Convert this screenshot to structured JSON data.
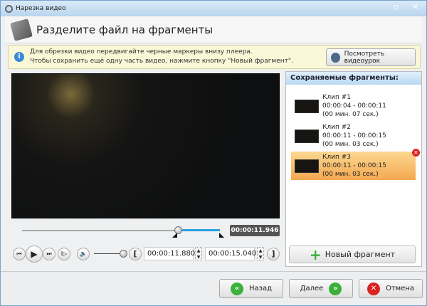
{
  "window": {
    "title": "Нарезка видео"
  },
  "header": {
    "title": "Разделите файл на фрагменты"
  },
  "info": {
    "line1": "Для обрезки видео передвигайте черные маркеры внизу плеера.",
    "line2": "Чтобы сохранить ещё одну часть видео, нажмите кнопку \"Новый фрагмент\".",
    "tutorial_button": "Посмотреть видеоурок"
  },
  "player": {
    "current_time": "00:00:11.946",
    "start_time": "00:00:11.880",
    "end_time": "00:00:15.040",
    "start_bracket": "[",
    "end_bracket": "]",
    "position_fraction": 0.82,
    "volume_fraction": 1.0
  },
  "fragments": {
    "title": "Сохраняемые фрагменты:",
    "items": [
      {
        "name": "Клип #1",
        "range": "00:00:04 - 00:00:11",
        "duration": "(00 мин. 07 сек.)"
      },
      {
        "name": "Клип #2",
        "range": "00:00:11 - 00:00:15",
        "duration": "(00 мин. 03 сек.)"
      },
      {
        "name": "Клип #3",
        "range": "00:00:11 - 00:00:15",
        "duration": "(00 мин. 03 сек.)"
      }
    ],
    "new_button": "Новый фрагмент"
  },
  "footer": {
    "back": "Назад",
    "next": "Далее",
    "cancel": "Отмена"
  }
}
